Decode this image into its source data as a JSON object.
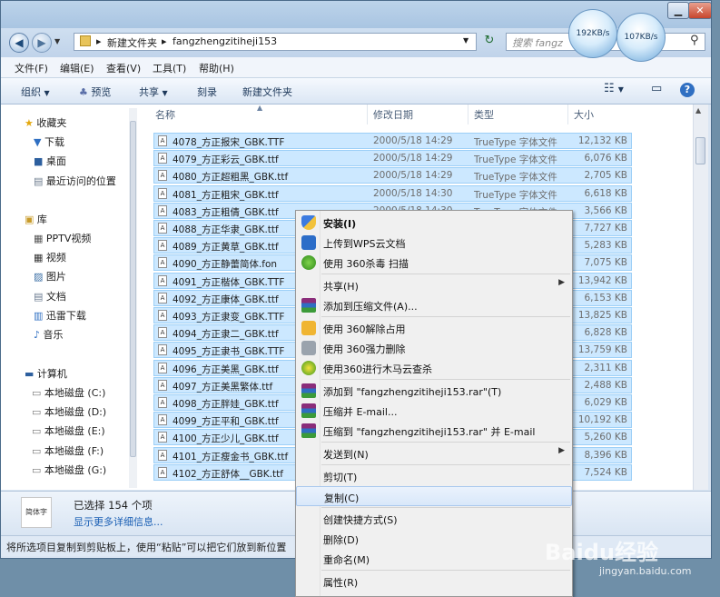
{
  "address": {
    "crumbs": [
      "新建文件夹",
      "fangzhengzitiheji153"
    ],
    "search_placeholder": "搜索 fangz"
  },
  "speed": {
    "up": "192KB/s",
    "down": "107KB/s"
  },
  "menubar": [
    "文件(F)",
    "编辑(E)",
    "查看(V)",
    "工具(T)",
    "帮助(H)"
  ],
  "toolbar": {
    "organize": "组织",
    "preview": "预览",
    "share": "共享",
    "burn": "刻录",
    "new_folder": "新建文件夹"
  },
  "nav": {
    "favorites": "收藏夹",
    "fav_items": [
      "下载",
      "桌面",
      "最近访问的位置"
    ],
    "libraries": "库",
    "lib_items": [
      "PPTV视频",
      "视频",
      "图片",
      "文档",
      "迅雷下载",
      "音乐"
    ],
    "computer": "计算机",
    "drives": [
      "本地磁盘 (C:)",
      "本地磁盘 (D:)",
      "本地磁盘 (E:)",
      "本地磁盘 (F:)",
      "本地磁盘 (G:)"
    ]
  },
  "columns": {
    "name": "名称",
    "date": "修改日期",
    "type": "类型",
    "size": "大小"
  },
  "files": [
    {
      "name": "4078_方正报宋_GBK.TTF",
      "date": "2000/5/18 14:29",
      "type": "TrueType 字体文件",
      "size": "12,132 KB"
    },
    {
      "name": "4079_方正彩云_GBK.ttf",
      "date": "2000/5/18 14:29",
      "type": "TrueType 字体文件",
      "size": "6,076 KB"
    },
    {
      "name": "4080_方正超粗黑_GBK.ttf",
      "date": "2000/5/18 14:29",
      "type": "TrueType 字体文件",
      "size": "2,705 KB"
    },
    {
      "name": "4081_方正粗宋_GBK.ttf",
      "date": "2000/5/18 14:30",
      "type": "TrueType 字体文件",
      "size": "6,618 KB"
    },
    {
      "name": "4083_方正粗倩_GBK.ttf",
      "date": "2000/5/18 14:30",
      "type": "TrueType 字体文件",
      "size": "3,566 KB"
    },
    {
      "name": "4088_方正华隶_GBK.ttf",
      "date": "",
      "type": "",
      "size": "7,727 KB"
    },
    {
      "name": "4089_方正黄草_GBK.ttf",
      "date": "",
      "type": "",
      "size": "5,283 KB"
    },
    {
      "name": "4090_方正静蕾简体.fon",
      "date": "",
      "type": "",
      "size": "7,075 KB"
    },
    {
      "name": "4091_方正楷体_GBK.TTF",
      "date": "",
      "type": "",
      "size": "13,942 KB"
    },
    {
      "name": "4092_方正康体_GBK.ttf",
      "date": "",
      "type": "",
      "size": "6,153 KB"
    },
    {
      "name": "4093_方正隶变_GBK.TTF",
      "date": "",
      "type": "",
      "size": "13,825 KB"
    },
    {
      "name": "4094_方正隶二_GBK.ttf",
      "date": "",
      "type": "",
      "size": "6,828 KB"
    },
    {
      "name": "4095_方正隶书_GBK.TTF",
      "date": "",
      "type": "",
      "size": "13,759 KB"
    },
    {
      "name": "4096_方正美黑_GBK.ttf",
      "date": "",
      "type": "",
      "size": "2,311 KB"
    },
    {
      "name": "4097_方正美黑繁体.ttf",
      "date": "",
      "type": "",
      "size": "2,488 KB"
    },
    {
      "name": "4098_方正胖娃_GBK.ttf",
      "date": "",
      "type": "",
      "size": "6,029 KB"
    },
    {
      "name": "4099_方正平和_GBK.ttf",
      "date": "",
      "type": "",
      "size": "10,192 KB"
    },
    {
      "name": "4100_方正少儿_GBK.ttf",
      "date": "",
      "type": "",
      "size": "5,260 KB"
    },
    {
      "name": "4101_方正瘦金书_GBK.ttf",
      "date": "",
      "type": "",
      "size": "8,396 KB"
    },
    {
      "name": "4102_方正舒体__GBK.ttf",
      "date": "",
      "type": "",
      "size": "7,524 KB"
    }
  ],
  "details": {
    "selected": "已选择 154 个项",
    "more": "显示更多详细信息...",
    "thumb_text": "简体字"
  },
  "status": "将所选项目复制到剪贴板上，使用“粘贴”可以把它们放到新位置",
  "context_menu": [
    {
      "label": "安装(I)",
      "bold": true,
      "icon": "shield-icon"
    },
    {
      "label": "上传到WPS云文档",
      "icon": "wps-cloud-icon"
    },
    {
      "label": "使用 360杀毒 扫描",
      "icon": "360-antivirus-icon"
    },
    {
      "sep": true
    },
    {
      "label": "共享(H)",
      "submenu": true
    },
    {
      "label": "添加到压缩文件(A)...",
      "icon": "winrar-icon"
    },
    {
      "sep": true
    },
    {
      "label": "使用 360解除占用",
      "icon": "360-unlock-icon"
    },
    {
      "label": "使用 360强力删除",
      "icon": "360-shred-icon"
    },
    {
      "label": "使用360进行木马云查杀",
      "icon": "360-trojan-scan-icon"
    },
    {
      "sep": true
    },
    {
      "label": "添加到 \"fangzhengzitiheji153.rar\"(T)",
      "icon": "winrar-icon"
    },
    {
      "label": "压缩并 E-mail...",
      "icon": "winrar-icon"
    },
    {
      "label": "压缩到 \"fangzhengzitiheji153.rar\" 并 E-mail",
      "icon": "winrar-icon"
    },
    {
      "sep": true
    },
    {
      "label": "发送到(N)",
      "submenu": true
    },
    {
      "sep": true
    },
    {
      "label": "剪切(T)"
    },
    {
      "label": "复制(C)",
      "highlighted": true
    },
    {
      "sep": true
    },
    {
      "label": "创建快捷方式(S)"
    },
    {
      "label": "删除(D)"
    },
    {
      "label": "重命名(M)"
    },
    {
      "sep": true
    },
    {
      "label": "属性(R)"
    }
  ],
  "watermark": {
    "brand": "Baidu经验",
    "url": "jingyan.baidu.com"
  }
}
